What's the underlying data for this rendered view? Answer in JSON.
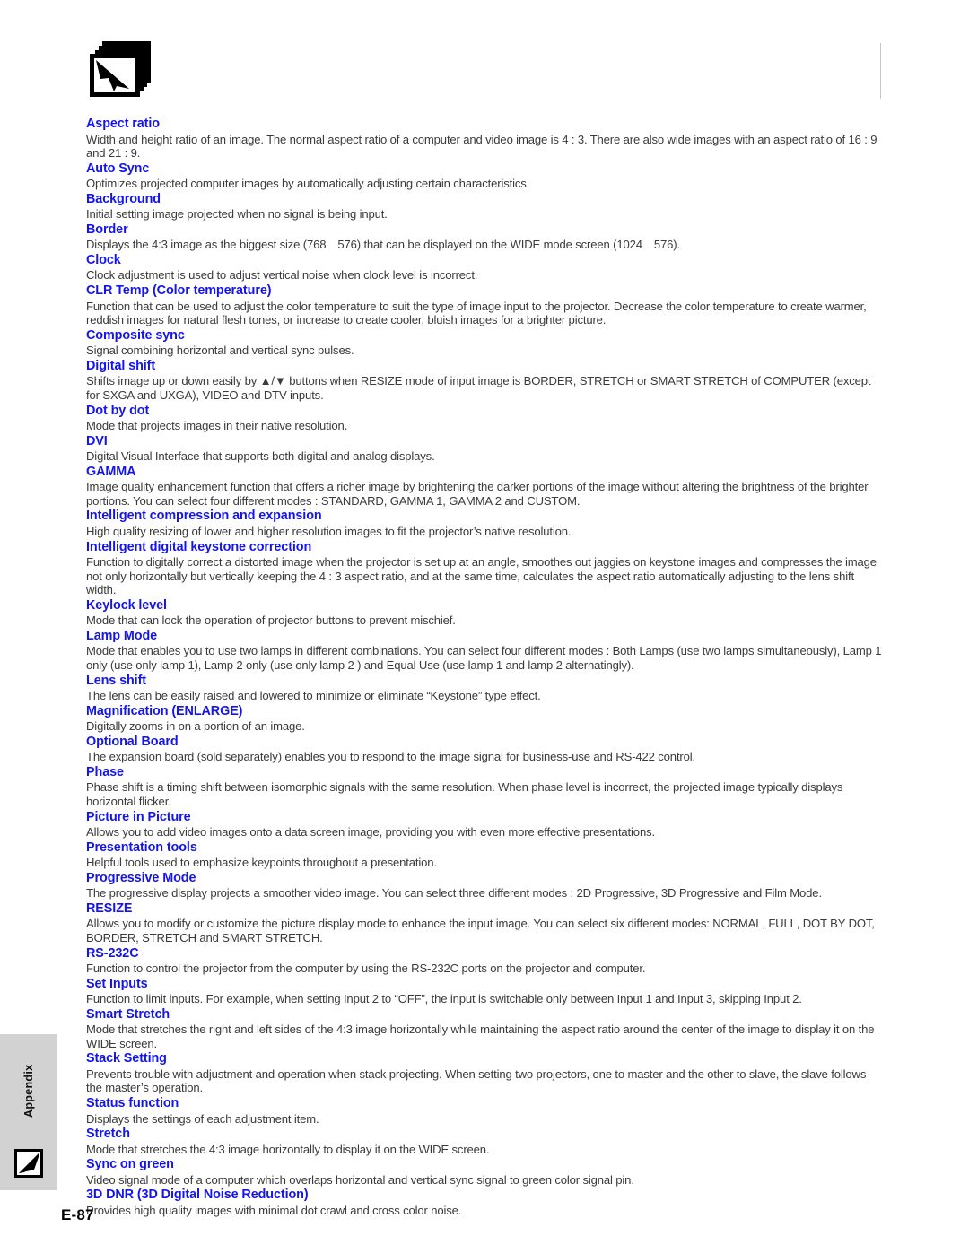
{
  "document": {
    "page_number": "E-87",
    "section_tab_label": "Appendix",
    "header_icon": "stacked-pages-icon",
    "tab_icon": "page-corner-icon",
    "colors": {
      "term": "#1414f0",
      "body": "#3a3a3a",
      "tab_background": "#d2d2d2",
      "rule": "#c9c9c9"
    }
  },
  "glossary": [
    {
      "term": "Aspect ratio",
      "desc": "Width and height ratio of an image. The normal aspect ratio of a computer and video image is 4 : 3. There are also wide images with an aspect ratio of 16 : 9 and 21 : 9."
    },
    {
      "term": "Auto Sync",
      "desc": "Optimizes projected computer images by automatically adjusting certain characteristics."
    },
    {
      "term": "Background",
      "desc": "Initial setting image projected when no signal is being input."
    },
    {
      "term": "Border",
      "desc_pre": "Displays the 4:3 image as the biggest size (768",
      "desc_mid": "576) that can be displayed on the WIDE mode screen (1024",
      "desc_post": "576)."
    },
    {
      "term": "Clock",
      "desc": "Clock adjustment is used to adjust vertical noise when clock level is incorrect."
    },
    {
      "term": "CLR Temp (Color temperature)",
      "desc": "Function that can be used to adjust the color temperature to suit the type of image input to the projector. Decrease the color temperature to create warmer, reddish images for natural flesh tones, or increase to create cooler, bluish images for a brighter picture."
    },
    {
      "term": "Composite sync",
      "desc": "Signal combining horizontal and vertical sync pulses."
    },
    {
      "term": "Digital shift",
      "desc_pre": "Shifts image up or down easily by",
      "desc_post": "buttons when RESIZE mode of input image is BORDER, STRETCH or SMART STRETCH of COMPUTER (except for SXGA and UXGA), VIDEO and DTV inputs.",
      "up_glyph": "▲",
      "separator": "/",
      "down_glyph": "▼"
    },
    {
      "term": "Dot by dot",
      "desc": "Mode that projects images in their native resolution."
    },
    {
      "term": "DVI",
      "desc": "Digital Visual Interface that supports both digital and analog displays."
    },
    {
      "term": "GAMMA",
      "desc": "Image quality enhancement function that offers a richer image by brightening the darker portions of the image without altering the brightness of the brighter portions. You can select four different modes : STANDARD, GAMMA 1, GAMMA 2 and CUSTOM."
    },
    {
      "term": "Intelligent compression and expansion",
      "desc": "High quality resizing of lower and higher resolution images to fit the projector’s native resolution."
    },
    {
      "term": "Intelligent digital keystone correction",
      "desc": "Function to digitally correct a distorted image when the projector is set up at an angle, smoothes out jaggies on keystone images and compresses the image not only horizontally but vertically keeping the 4 : 3 aspect ratio, and at the same time, calculates the aspect ratio automatically adjusting to the lens shift width."
    },
    {
      "term": "Keylock level",
      "desc": "Mode that can lock the operation of projector buttons to prevent mischief."
    },
    {
      "term": "Lamp Mode",
      "desc": "Mode that enables you to use two lamps in different combinations. You can select four different modes : Both Lamps (use two lamps simultaneously), Lamp 1 only (use only lamp 1), Lamp 2 only (use only lamp 2 ) and Equal Use (use lamp 1 and lamp 2 alternatingly)."
    },
    {
      "term": "Lens shift",
      "desc": "The lens can be easily raised and lowered to minimize or eliminate “Keystone” type effect."
    },
    {
      "term": "Magnification (ENLARGE)",
      "desc": "Digitally zooms in on a portion of an image."
    },
    {
      "term": "Optional Board",
      "desc": "The expansion board (sold separately) enables you to respond to the image signal for business-use and RS-422 control."
    },
    {
      "term": "Phase",
      "desc": "Phase shift is a timing shift between isomorphic signals with the same resolution. When phase level is incorrect, the projected image typically displays horizontal flicker."
    },
    {
      "term": "Picture in Picture",
      "desc": "Allows you to add video images onto a data screen image, providing you with even more effective presentations."
    },
    {
      "term": "Presentation tools",
      "desc": "Helpful tools used to emphasize keypoints throughout a presentation."
    },
    {
      "term": "Progressive Mode",
      "desc": "The progressive display projects a smoother video image. You can select three different modes : 2D Progressive, 3D Progressive and Film Mode."
    },
    {
      "term": "RESIZE",
      "desc": "Allows you to modify or customize the picture display mode to enhance the input image. You can select six different modes: NORMAL, FULL, DOT BY DOT, BORDER, STRETCH and SMART STRETCH."
    },
    {
      "term": "RS-232C",
      "desc": "Function to control the projector from the computer by using the RS-232C ports on the projector and computer."
    },
    {
      "term": "Set Inputs",
      "desc": "Function to limit inputs. For example, when setting Input 2 to “OFF”, the input is switchable only between Input 1 and Input 3, skipping Input 2."
    },
    {
      "term": "Smart Stretch",
      "desc": "Mode that stretches the right and left sides of the 4:3 image horizontally while maintaining the aspect ratio around the center of the image to display it on the WIDE screen."
    },
    {
      "term": "Stack Setting",
      "desc": "Prevents trouble with adjustment and operation when stack projecting. When setting two projectors, one to master and the other to slave, the slave follows the master’s operation."
    },
    {
      "term": "Status function",
      "desc": "Displays the settings of each adjustment item."
    },
    {
      "term": "Stretch",
      "desc": "Mode that stretches the 4:3 image horizontally to display it on the WIDE screen."
    },
    {
      "term": "Sync on green",
      "desc": "Video signal mode of a computer which overlaps horizontal and vertical sync signal to green color signal pin."
    },
    {
      "term": "3D DNR (3D Digital Noise Reduction)",
      "desc": "Provides high quality images with minimal dot crawl and cross color noise."
    }
  ]
}
